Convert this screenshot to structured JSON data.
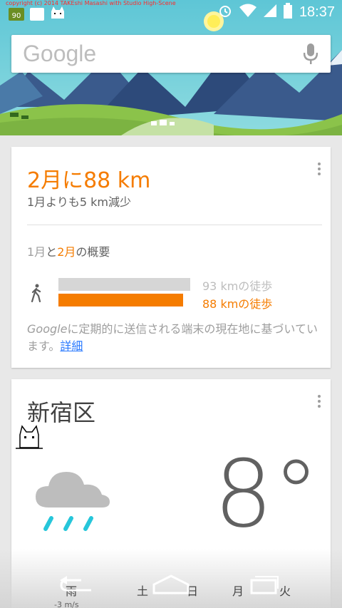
{
  "status_bar": {
    "copyright": "copyright (c) 2014 TAKEshi Masashi with Studio High-Scene",
    "battery_badge": "90",
    "time": "18:37"
  },
  "search": {
    "logo": "Google"
  },
  "card_distance": {
    "headline": "2月に88 km",
    "subline": "1月よりも5 km減少",
    "overview_jan": "1月",
    "overview_and": "と",
    "overview_feb": "2月",
    "overview_suffix": "の概要",
    "jan_label": "93 kmの徒歩",
    "feb_label": "88 kmの徒歩",
    "jan_km": 93,
    "feb_km": 88,
    "note_google": "Google",
    "note_text": "に定期的に送信される端末の現在地に基づいています。",
    "note_link": "詳細"
  },
  "card_weather": {
    "place": "新宿区",
    "temperature": "8°",
    "days": [
      "雨",
      "土",
      "日",
      "月",
      "火"
    ],
    "wind": "-3 m/s"
  },
  "colors": {
    "accent": "#f57c00",
    "link": "#2979ff"
  }
}
